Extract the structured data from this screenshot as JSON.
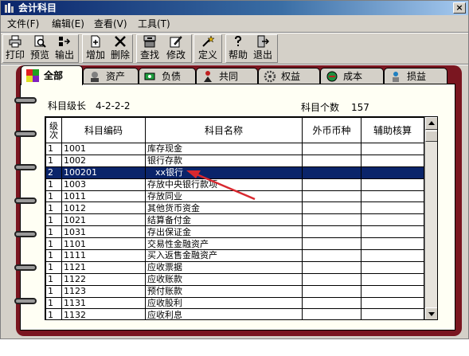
{
  "window": {
    "title": "会计科目",
    "close_glyph": "×"
  },
  "menu": [
    {
      "label": "文件(F)"
    },
    {
      "label": "编辑(E)"
    },
    {
      "label": "查看(V)"
    },
    {
      "label": "工具(T)"
    }
  ],
  "toolbar": [
    {
      "label": "打印",
      "icon": "printer-icon"
    },
    {
      "label": "预览",
      "icon": "preview-icon"
    },
    {
      "label": "输出",
      "icon": "export-icon"
    },
    {
      "label": "增加",
      "icon": "add-icon"
    },
    {
      "label": "删除",
      "icon": "delete-icon"
    },
    {
      "label": "查找",
      "icon": "find-icon"
    },
    {
      "label": "修改",
      "icon": "edit-icon"
    },
    {
      "label": "定义",
      "icon": "define-icon"
    },
    {
      "label": "帮助",
      "icon": "help-icon"
    },
    {
      "label": "退出",
      "icon": "exit-icon"
    }
  ],
  "tabs": [
    {
      "label": "全部",
      "active": true
    },
    {
      "label": "资产"
    },
    {
      "label": "负债"
    },
    {
      "label": "共同"
    },
    {
      "label": "权益"
    },
    {
      "label": "成本"
    },
    {
      "label": "损益"
    }
  ],
  "info": {
    "level_label": "科目级长",
    "level_value": "4-2-2-2",
    "count_label": "科目个数",
    "count_value": "157"
  },
  "columns": {
    "level": "级次",
    "code": "科目编码",
    "name": "科目名称",
    "currency": "外币币种",
    "aux": "辅助核算"
  },
  "rows": [
    {
      "level": "1",
      "code": "1001",
      "name": "库存现金"
    },
    {
      "level": "1",
      "code": "1002",
      "name": "银行存款"
    },
    {
      "level": "2",
      "code": "100201",
      "name": "xx银行",
      "selected": true
    },
    {
      "level": "1",
      "code": "1003",
      "name": "存放中央银行款项"
    },
    {
      "level": "1",
      "code": "1011",
      "name": "存放同业"
    },
    {
      "level": "1",
      "code": "1012",
      "name": "其他货币资金"
    },
    {
      "level": "1",
      "code": "1021",
      "name": "结算备付金"
    },
    {
      "level": "1",
      "code": "1031",
      "name": "存出保证金"
    },
    {
      "level": "1",
      "code": "1101",
      "name": "交易性金融资产"
    },
    {
      "level": "1",
      "code": "1111",
      "name": "买入返售金融资产"
    },
    {
      "level": "1",
      "code": "1121",
      "name": "应收票据"
    },
    {
      "level": "1",
      "code": "1122",
      "name": "应收账款"
    },
    {
      "level": "1",
      "code": "1123",
      "name": "预付账款"
    },
    {
      "level": "1",
      "code": "1131",
      "name": "应收股利"
    },
    {
      "level": "1",
      "code": "1132",
      "name": "应收利息"
    }
  ],
  "colors": {
    "title_bar": "#0a246a",
    "binder": "#7a1620",
    "selection": "#0a246a",
    "annotation_arrow": "#d8282f"
  }
}
